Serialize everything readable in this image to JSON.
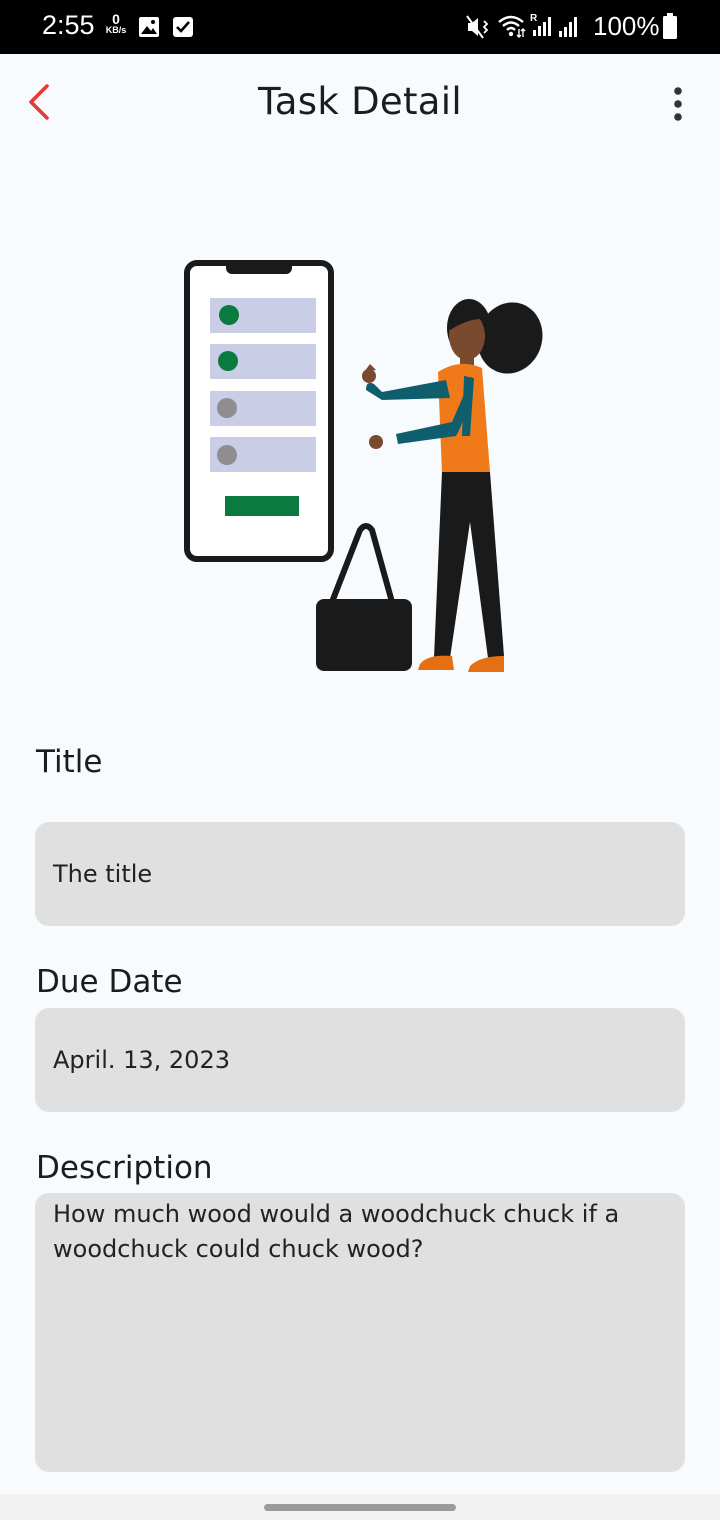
{
  "status_bar": {
    "time": "2:55",
    "net_speed_value": "0",
    "net_speed_unit": "KB/s",
    "battery_text": "100%",
    "icons": [
      "image-icon",
      "checkbox-notification-icon",
      "mute-vibrate-icon",
      "wifi-icon",
      "signal-roaming-icon",
      "signal-icon",
      "battery-icon"
    ]
  },
  "app_bar": {
    "title": "Task Detail",
    "back_icon": "chevron-left-icon",
    "menu_icon": "more-vertical-icon",
    "accent_color": "#e53935"
  },
  "form": {
    "title": {
      "label": "Title",
      "value": "The title"
    },
    "due_date": {
      "label": "Due Date",
      "value": "April. 13, 2023"
    },
    "description": {
      "label": "Description",
      "value": "How much wood would a woodchuck chuck if a woodchuck could chuck wood?"
    }
  },
  "colors": {
    "background": "#f7fbfd",
    "field_background": "#e0e0e0",
    "checked_dot": "#0a7a3e",
    "unchecked_dot": "#8e8e8e"
  }
}
